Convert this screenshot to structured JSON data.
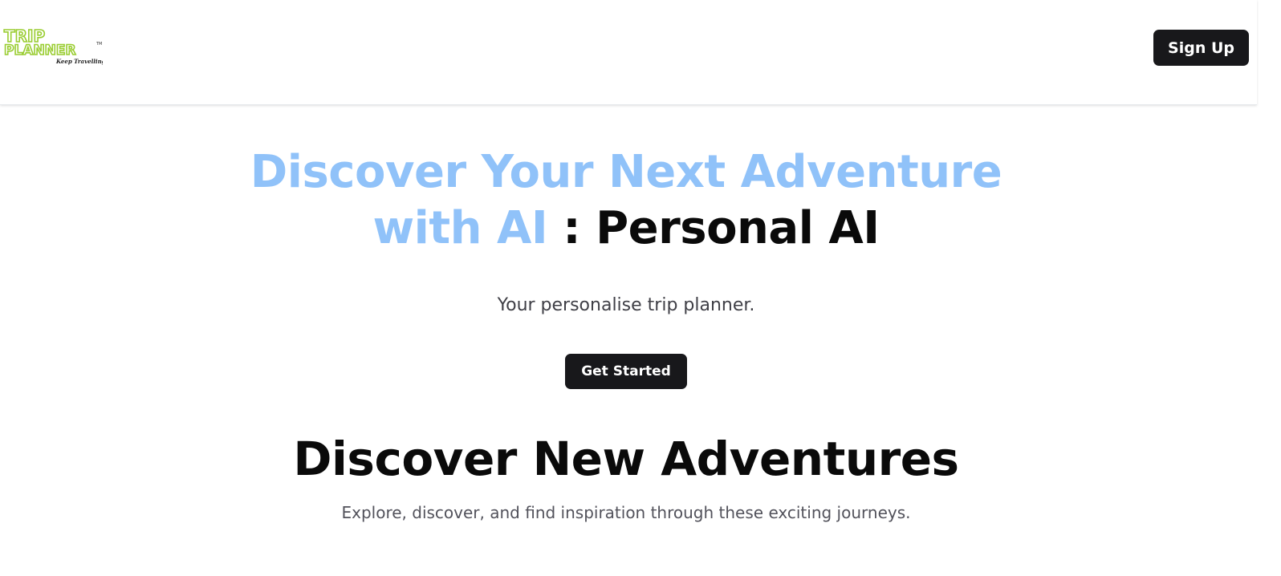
{
  "header": {
    "logo": {
      "line1": "TRIP",
      "line2": "PLANNER",
      "trademark": "TM",
      "tagline": "Keep Travelling",
      "color": "#9acd32"
    },
    "signup_label": "Sign Up"
  },
  "hero": {
    "title_accent": "Discover Your Next Adventure with AI",
    "title_separator": ":",
    "title_dark": "Personal AI",
    "subtitle": "Your personalise trip planner.",
    "cta_label": "Get Started"
  },
  "section": {
    "title": "Discover New Adventures",
    "subtitle": "Explore, discover, and find inspiration through these exciting journeys."
  },
  "colors": {
    "accent": "#90c2f9",
    "button_bg": "#18181b",
    "text_dark": "#0a0a0a"
  }
}
